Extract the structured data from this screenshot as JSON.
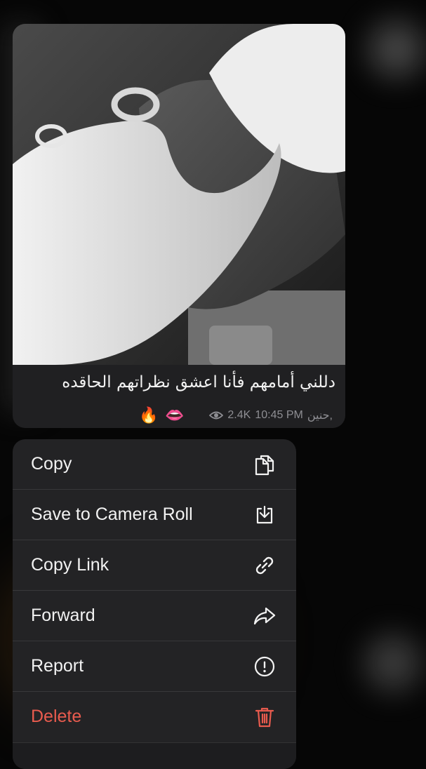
{
  "message": {
    "caption": "دللني أمامهم  فأنا اعشق نظراتهم الحاقده",
    "reactions": [
      "🔥",
      "👄"
    ],
    "views": "2.4K",
    "time": "10:45 PM",
    "author": "حنين,"
  },
  "menu": {
    "items": [
      {
        "label": "Copy",
        "icon": "copy-icon"
      },
      {
        "label": "Save to Camera Roll",
        "icon": "save-to-camera-roll-icon"
      },
      {
        "label": "Copy Link",
        "icon": "link-icon"
      },
      {
        "label": "Forward",
        "icon": "forward-icon"
      },
      {
        "label": "Report",
        "icon": "report-icon"
      },
      {
        "label": "Delete",
        "icon": "trash-icon"
      }
    ]
  },
  "colors": {
    "delete": "#e85b4e",
    "menu_bg": "#232325",
    "bubble_bg": "#202022"
  }
}
